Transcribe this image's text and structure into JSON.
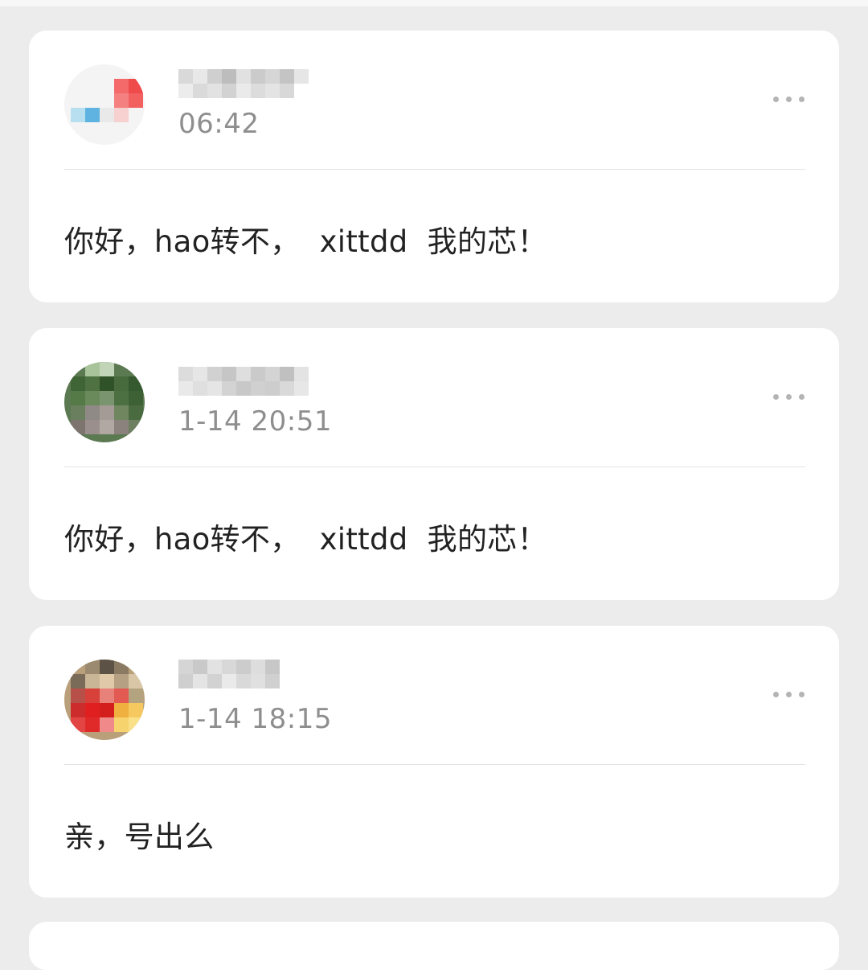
{
  "posts": [
    {
      "timestamp": "06:42",
      "message": "你好，hao转不，  xittdd  我的芯！",
      "avatar_icon": "user-avatar",
      "more_icon": "more-dots-icon"
    },
    {
      "timestamp": "1-14 20:51",
      "message": "你好，hao转不，  xittdd  我的芯！",
      "avatar_icon": "user-avatar",
      "more_icon": "more-dots-icon"
    },
    {
      "timestamp": "1-14 18:15",
      "message": "亲，号出么",
      "avatar_icon": "user-avatar",
      "more_icon": "more-dots-icon"
    }
  ],
  "colors": {
    "background": "#ececec",
    "card": "#ffffff",
    "timestamp_text": "#8e8e8e",
    "message_text": "#222222",
    "divider": "#e3e3e3",
    "more_dots": "#b4b4b4"
  }
}
